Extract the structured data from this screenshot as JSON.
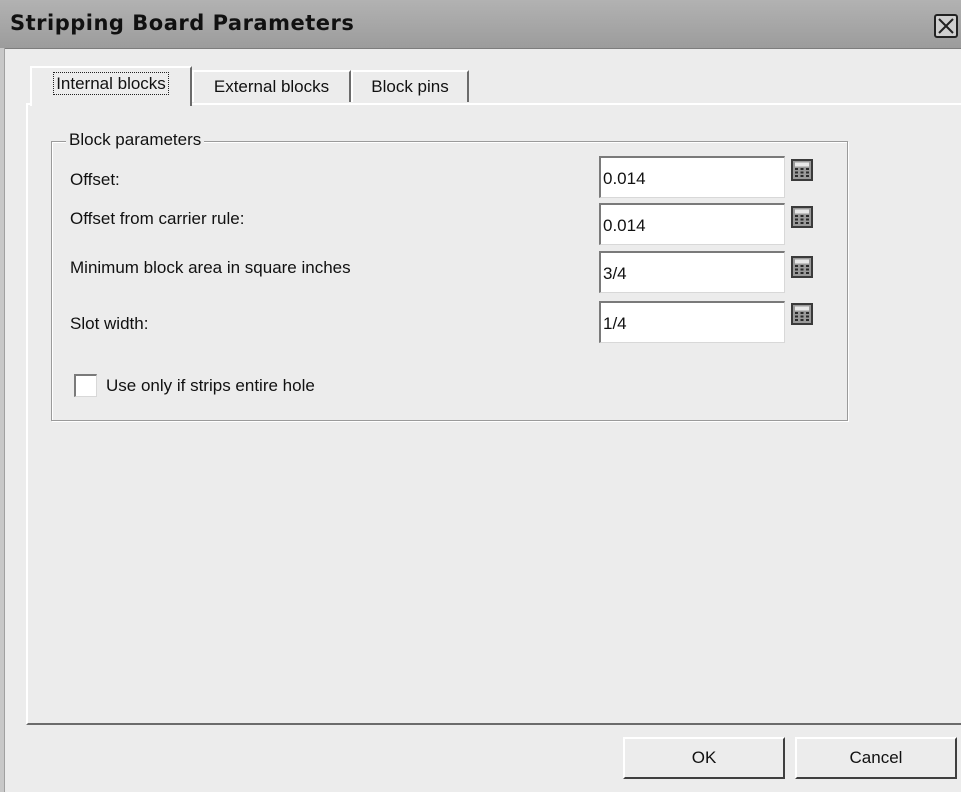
{
  "window": {
    "title": "Stripping Board Parameters"
  },
  "tabs": [
    {
      "label": "Internal blocks",
      "active": true
    },
    {
      "label": "External blocks",
      "active": false
    },
    {
      "label": "Block pins",
      "active": false
    }
  ],
  "block_parameters": {
    "group_label": "Block parameters",
    "fields": [
      {
        "label": "Offset:",
        "value": "0.014",
        "icon": "calculator-icon"
      },
      {
        "label": "Offset from carrier rule:",
        "value": "0.014",
        "icon": "calculator-icon"
      },
      {
        "label": "Minimum block area in square inches",
        "value": "3/4",
        "icon": "calculator-icon"
      },
      {
        "label": "Slot width:",
        "value": "1/4",
        "icon": "calculator-icon"
      }
    ],
    "checkbox": {
      "label": "Use only if strips entire hole",
      "checked": false
    }
  },
  "buttons": {
    "ok_label": "OK",
    "cancel_label": "Cancel"
  },
  "colors": {
    "dialog_background": "#ececec",
    "titlebar": "#a8a8a8"
  }
}
